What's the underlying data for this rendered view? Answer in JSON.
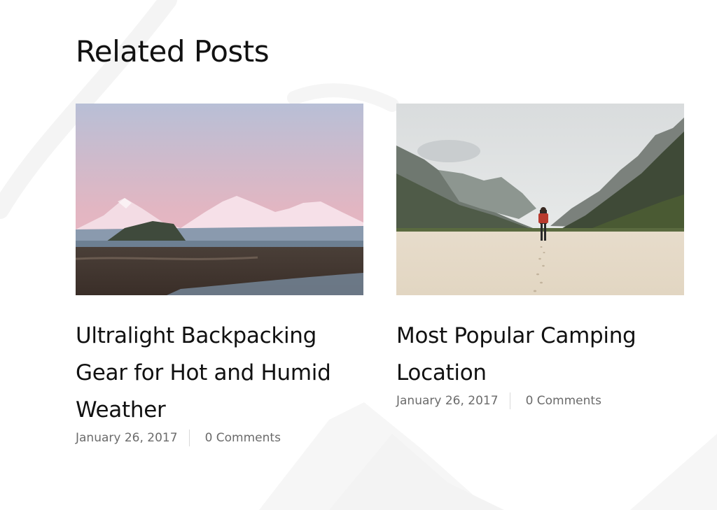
{
  "section": {
    "title": "Related Posts"
  },
  "posts": [
    {
      "title": "Ultralight Backpacking Gear for Hot and Humid Weather",
      "date": "January 26, 2017",
      "comments": "0 Comments",
      "image": "snowy-mountains-coast"
    },
    {
      "title": "Most Popular Camping Location",
      "date": "January 26, 2017",
      "comments": "0 Comments",
      "image": "hiker-mountain-valley"
    }
  ]
}
